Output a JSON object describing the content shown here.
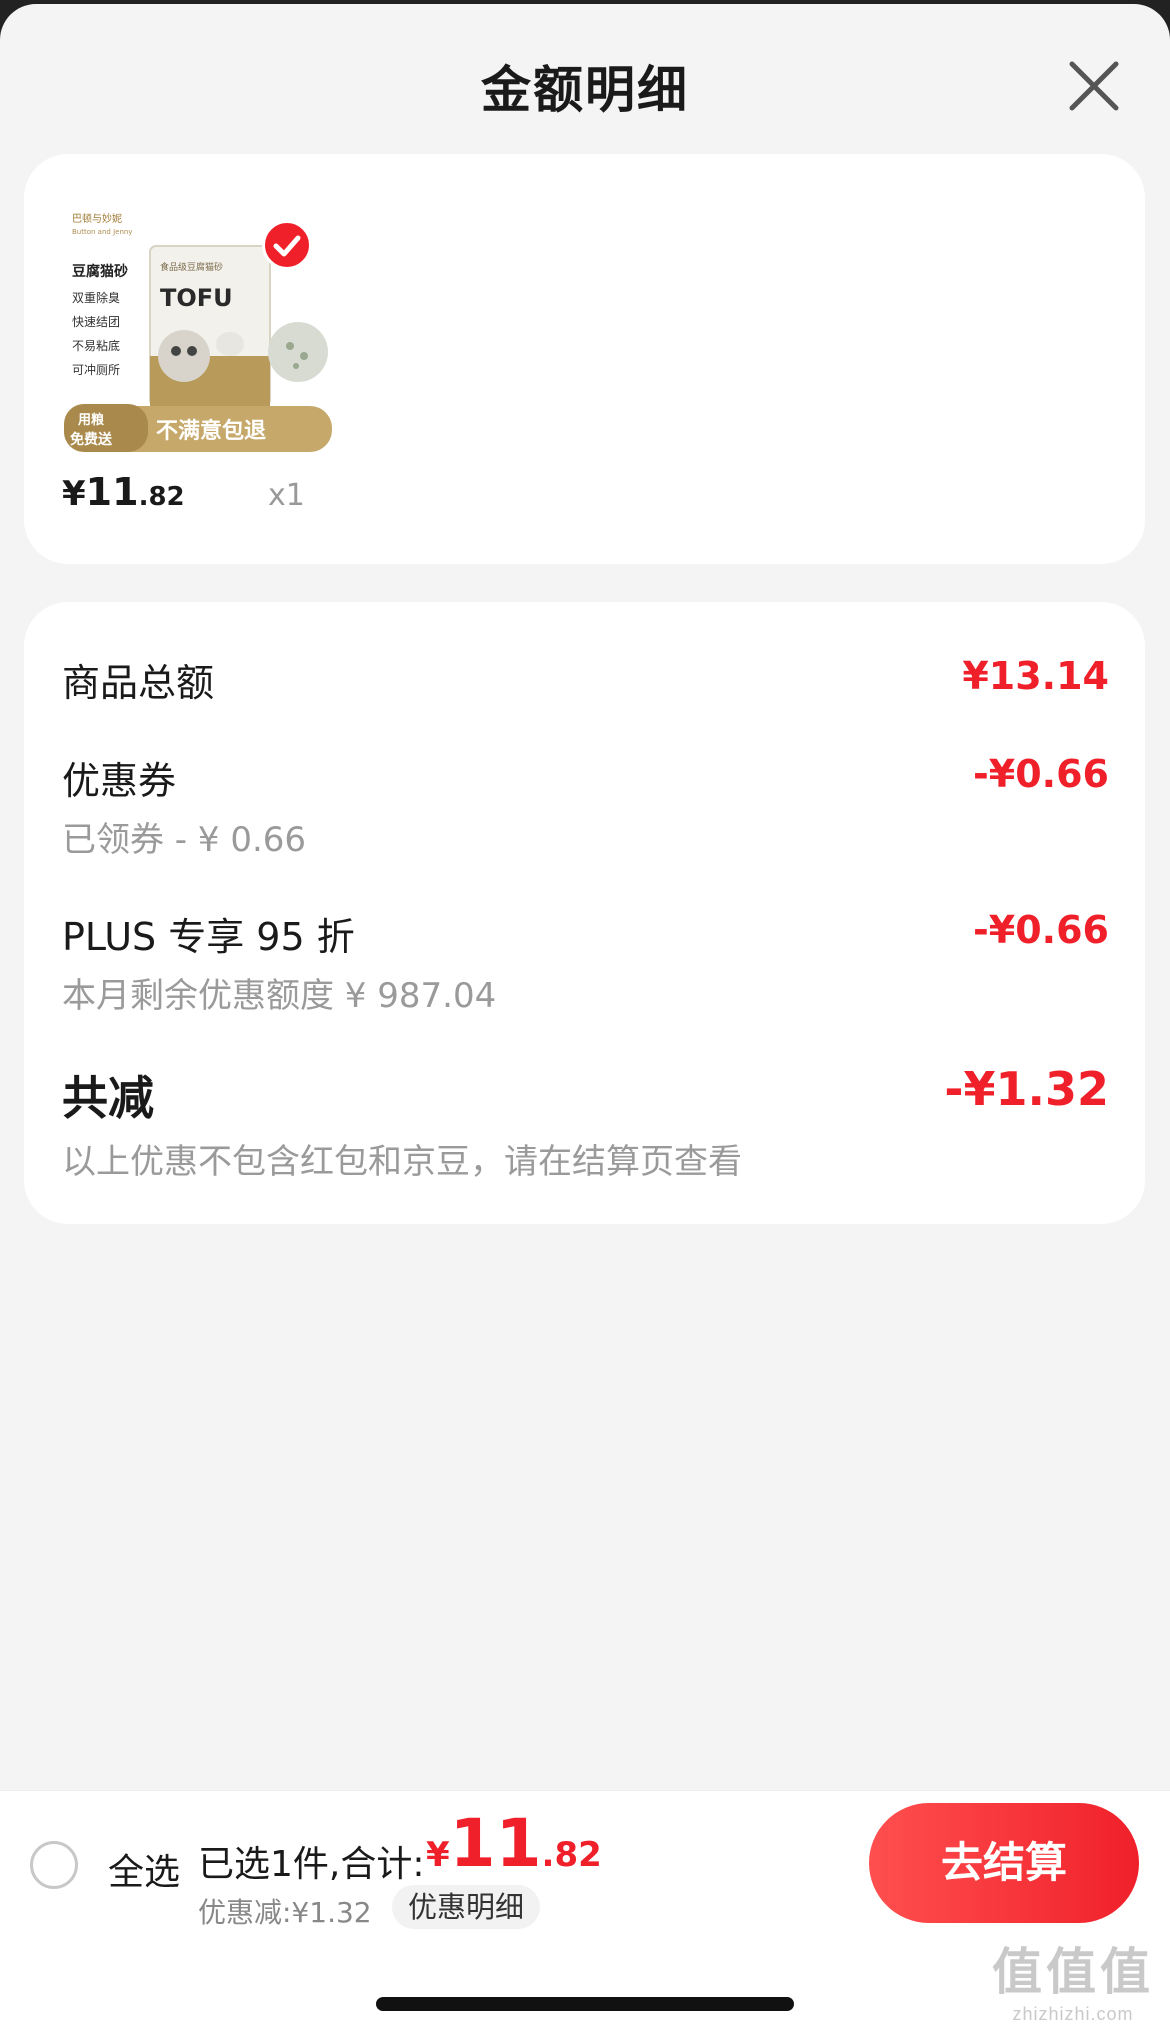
{
  "header": {
    "title": "金额明细",
    "close_icon": "close-icon"
  },
  "product": {
    "image_icon": "product-thumbnail",
    "image_texts": {
      "brand": "巴顿与妙妮",
      "brand_en": "Button and Jenny",
      "title": "豆腐猫砂",
      "features": [
        "双重除臭",
        "快速结团",
        "不易粘底",
        "可冲厕所"
      ],
      "bag_title": "食品级豆腐猫砂",
      "bag_tofu": "TOFU",
      "promo_left_1": "用粮",
      "promo_left_2": "免费送",
      "promo_right": "不满意包退"
    },
    "selected": true,
    "price_currency": "¥",
    "price_int": "11",
    "price_dec": ".82",
    "quantity": "x1"
  },
  "summary": {
    "goods_total_label": "商品总额",
    "goods_total_value": "¥13.14",
    "coupon_label": "优惠券",
    "coupon_value": "-¥0.66",
    "coupon_sub": "已领券 - ¥ 0.66",
    "plus_label": "PLUS 专享 95 折",
    "plus_value": "-¥0.66",
    "plus_sub": "本月剩余优惠额度 ¥ 987.04",
    "total_reduce_label": "共减",
    "total_reduce_value": "-¥1.32",
    "total_reduce_note": "以上优惠不包含红包和京豆，请在结算页查看"
  },
  "bottom_bar": {
    "select_all_label": "全选",
    "selected_text": "已选1件,合计:",
    "total_currency": "¥",
    "total_int": "11",
    "total_dec": ".82",
    "discount_text": "优惠减:¥1.32",
    "detail_link": "优惠明细",
    "checkout_label": "去结算"
  },
  "watermark": {
    "main": "值值值",
    "sub": "zhizhizhi.com"
  },
  "colors": {
    "accent": "#f0202a",
    "text": "#1a1a1a",
    "muted": "#9a9a9a",
    "background": "#f4f4f4"
  }
}
